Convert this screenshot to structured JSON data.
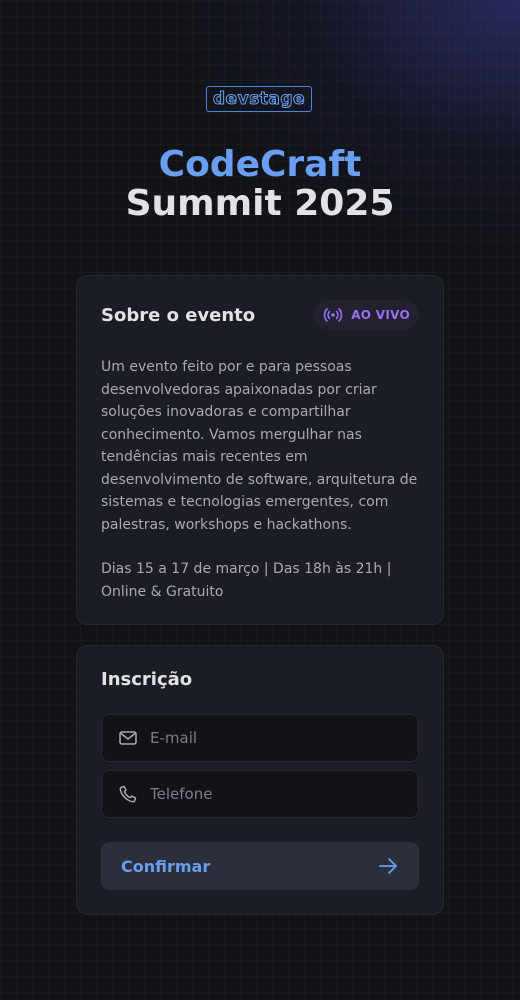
{
  "logo": {
    "text": "devstage"
  },
  "title": {
    "line1": "CodeCraft",
    "line2": "Summit 2025"
  },
  "about": {
    "title": "Sobre o evento",
    "badge": "AO VIVO",
    "description": "Um evento feito por e para pessoas desenvolvedoras apaixonadas por criar soluções inovadoras e compartilhar conhecimento. Vamos mergulhar nas tendências mais recentes em desenvolvimento de software, arquitetura de sistemas e tecnologias emergentes, com palestras, workshops e hackathons.",
    "dates": "Dias 15 a 17 de março | Das 18h às 21h | Online & Gratuito"
  },
  "subscription": {
    "title": "Inscrição",
    "email_placeholder": "E-mail",
    "phone_placeholder": "Telefone",
    "confirm_label": "Confirmar"
  },
  "icons": {
    "badge": "radio-live-icon",
    "email": "mail-icon",
    "phone": "phone-icon",
    "confirm": "arrow-right-icon"
  },
  "colors": {
    "accent_blue": "#6a9ef2",
    "accent_purple": "#9871f5",
    "background": "#111317",
    "card": "#1b1d24"
  }
}
